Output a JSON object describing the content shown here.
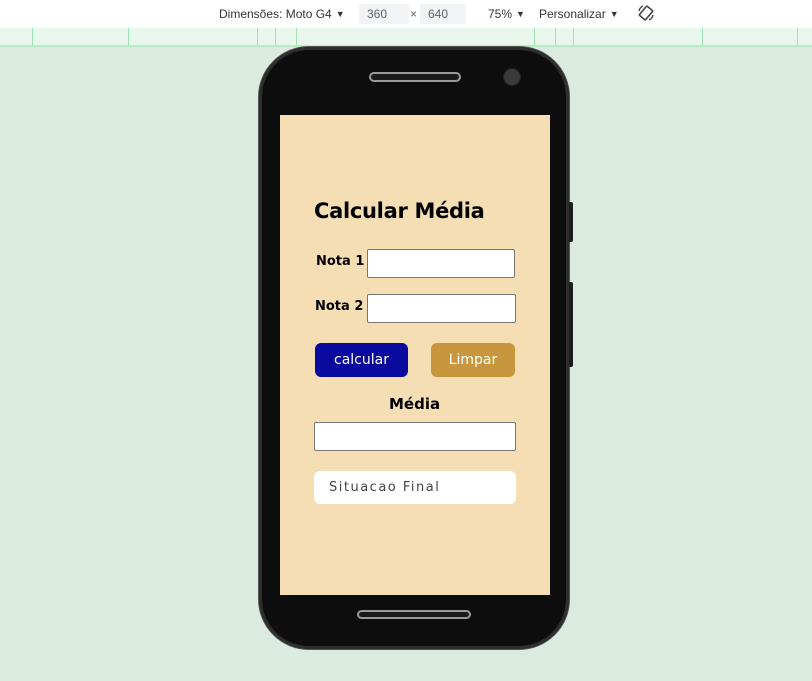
{
  "devtools": {
    "device_label": "Dimensões: Moto G4",
    "width_value": "360",
    "times_sign": "×",
    "height_value": "640",
    "zoom_label": "75%",
    "throttle_label": "Personalizar"
  },
  "app": {
    "title": "Calcular Média",
    "nota1_label": "Nota 1",
    "nota1_value": "",
    "nota2_label": "Nota 2",
    "nota2_value": "",
    "calcular_label": "calcular",
    "limpar_label": "Limpar",
    "media_label": "Média",
    "media_value": "",
    "situacao_text": "Situacao Final"
  },
  "colors": {
    "page_background": "#dcebe0",
    "screen_background": "#f5deb3",
    "calcular_button": "#0a0a9e",
    "limpar_button": "#c8963c"
  }
}
